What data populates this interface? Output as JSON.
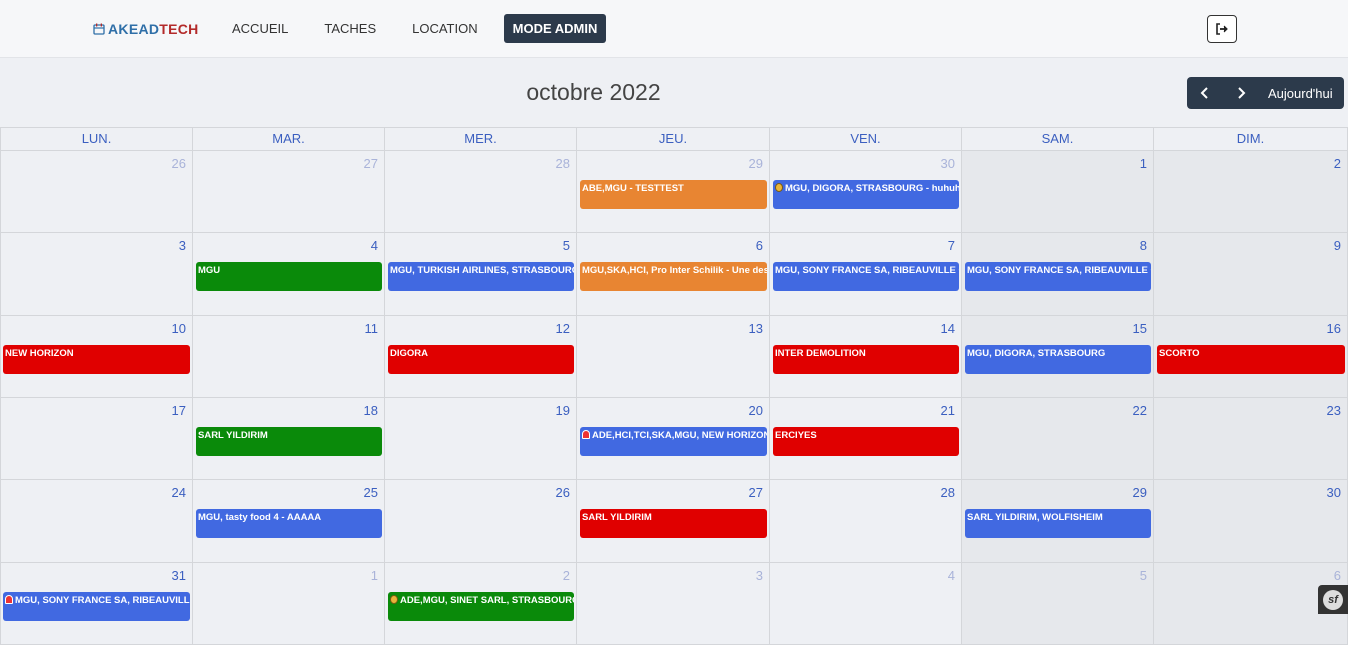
{
  "app": {
    "logo_part1": "AKEAD",
    "logo_part2": "TECH"
  },
  "nav": [
    {
      "label": "ACCUEIL",
      "active": false
    },
    {
      "label": "TACHES",
      "active": false
    },
    {
      "label": "LOCATION",
      "active": false
    },
    {
      "label": "MODE ADMIN",
      "active": true
    }
  ],
  "calendar": {
    "title": "octobre 2022",
    "today_label": "Aujourd'hui",
    "weekdays": [
      "LUN.",
      "MAR.",
      "MER.",
      "JEU.",
      "VEN.",
      "SAM.",
      "DIM."
    ],
    "weeks": [
      [
        "26",
        "27",
        "28",
        "29",
        "30",
        "1",
        "2"
      ],
      [
        "3",
        "4",
        "5",
        "6",
        "7",
        "8",
        "9"
      ],
      [
        "10",
        "11",
        "12",
        "13",
        "14",
        "15",
        "16"
      ],
      [
        "17",
        "18",
        "19",
        "20",
        "21",
        "22",
        "23"
      ],
      [
        "24",
        "25",
        "26",
        "27",
        "28",
        "29",
        "30"
      ],
      [
        "31",
        "1",
        "2",
        "3",
        "4",
        "5",
        "6"
      ]
    ],
    "outside_month": [
      [
        true,
        true,
        true,
        true,
        true,
        false,
        false
      ],
      [
        false,
        false,
        false,
        false,
        false,
        false,
        false
      ],
      [
        false,
        false,
        false,
        false,
        false,
        false,
        false
      ],
      [
        false,
        false,
        false,
        false,
        false,
        false,
        false
      ],
      [
        false,
        false,
        false,
        false,
        false,
        false,
        false
      ],
      [
        false,
        true,
        true,
        true,
        true,
        true,
        true
      ]
    ],
    "events": [
      {
        "week": 0,
        "day": 3,
        "text": "ABE,MGU - TESTTEST",
        "color": "#e88532",
        "icon": ""
      },
      {
        "week": 0,
        "day": 4,
        "text": "MGU, DIGORA, STRASBOURG - huhuhuhuhu",
        "color": "#4169e1",
        "icon": "bag"
      },
      {
        "week": 1,
        "day": 1,
        "text": "MGU",
        "color": "#0a8a0a",
        "icon": ""
      },
      {
        "week": 1,
        "day": 2,
        "text": "MGU, TURKISH AIRLINES, STRASBOURG - ...",
        "color": "#4169e1",
        "icon": ""
      },
      {
        "week": 1,
        "day": 3,
        "text": "MGU,SKA,HCI, Pro Inter Schilik - Une description",
        "color": "#e88532",
        "icon": ""
      },
      {
        "week": 1,
        "day": 4,
        "text": "MGU, SONY FRANCE SA, RIBEAUVILLE CEDEX",
        "color": "#4169e1",
        "icon": ""
      },
      {
        "week": 1,
        "day": 5,
        "text": "MGU, SONY FRANCE SA, RIBEAUVILLE CEDEX",
        "color": "#4169e1",
        "icon": ""
      },
      {
        "week": 2,
        "day": 0,
        "text": "NEW HORIZON",
        "color": "#e00000",
        "icon": ""
      },
      {
        "week": 2,
        "day": 2,
        "text": "DIGORA",
        "color": "#e00000",
        "icon": ""
      },
      {
        "week": 2,
        "day": 4,
        "text": "INTER DEMOLITION",
        "color": "#e00000",
        "icon": ""
      },
      {
        "week": 2,
        "day": 5,
        "text": "MGU, DIGORA, STRASBOURG",
        "color": "#4169e1",
        "icon": ""
      },
      {
        "week": 2,
        "day": 6,
        "text": "SCORTO",
        "color": "#e00000",
        "icon": ""
      },
      {
        "week": 3,
        "day": 1,
        "text": "SARL YILDIRIM",
        "color": "#0a8a0a",
        "icon": ""
      },
      {
        "week": 3,
        "day": 3,
        "text": "ADE,HCI,TCI,SKA,MGU, NEW HORIZON, ...",
        "color": "#4169e1",
        "icon": "alert"
      },
      {
        "week": 3,
        "day": 4,
        "text": "ERCIYES",
        "color": "#e00000",
        "icon": ""
      },
      {
        "week": 4,
        "day": 1,
        "text": "MGU, tasty food 4 - AAAAA",
        "color": "#4169e1",
        "icon": ""
      },
      {
        "week": 4,
        "day": 3,
        "text": "SARL YILDIRIM",
        "color": "#e00000",
        "icon": ""
      },
      {
        "week": 4,
        "day": 5,
        "text": "SARL YILDIRIM, WOLFISHEIM",
        "color": "#4169e1",
        "icon": ""
      },
      {
        "week": 5,
        "day": 0,
        "text": "MGU, SONY FRANCE SA, RIBEAUVILLE CEDEX",
        "color": "#4169e1",
        "icon": "alert"
      },
      {
        "week": 5,
        "day": 2,
        "text": "ADE,MGU, SINET SARL, STRASBOURG - ...",
        "color": "#0a8a0a",
        "icon": "bag"
      }
    ]
  },
  "debug_badge": "sf"
}
